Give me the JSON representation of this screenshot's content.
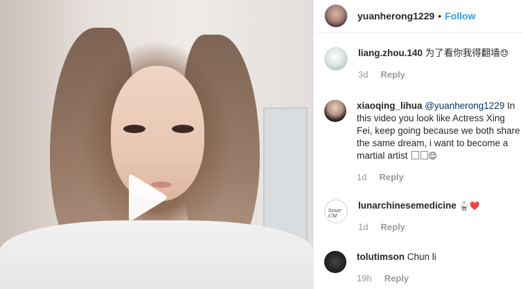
{
  "header": {
    "username": "yuanherong1229",
    "separator": "•",
    "follow_label": "Follow"
  },
  "comments": [
    {
      "username": "liang.zhou.140",
      "text": "为了看你我得翻墙",
      "emoji": "😓",
      "time": "3d",
      "reply_label": "Reply"
    },
    {
      "username": "xiaoqing_lihua",
      "mention": "@yuanherong1229",
      "text": "In this video you look like Actress Xing Fei, keep going because we both share the same dream, i want to become a martial artist",
      "emoji": "😌",
      "time": "1d",
      "reply_label": "Reply"
    },
    {
      "username": "lunarchinesemedicine",
      "emoji": "🥋❤️",
      "avatar_text": "lunar CM",
      "time": "1d",
      "reply_label": "Reply"
    },
    {
      "username": "tolutimson",
      "text": "Chun li",
      "time": "19h",
      "reply_label": "Reply"
    }
  ],
  "colors": {
    "follow": "#3897f0",
    "meta": "#999999",
    "text": "#262626"
  },
  "icons": {
    "play": "play-icon"
  }
}
